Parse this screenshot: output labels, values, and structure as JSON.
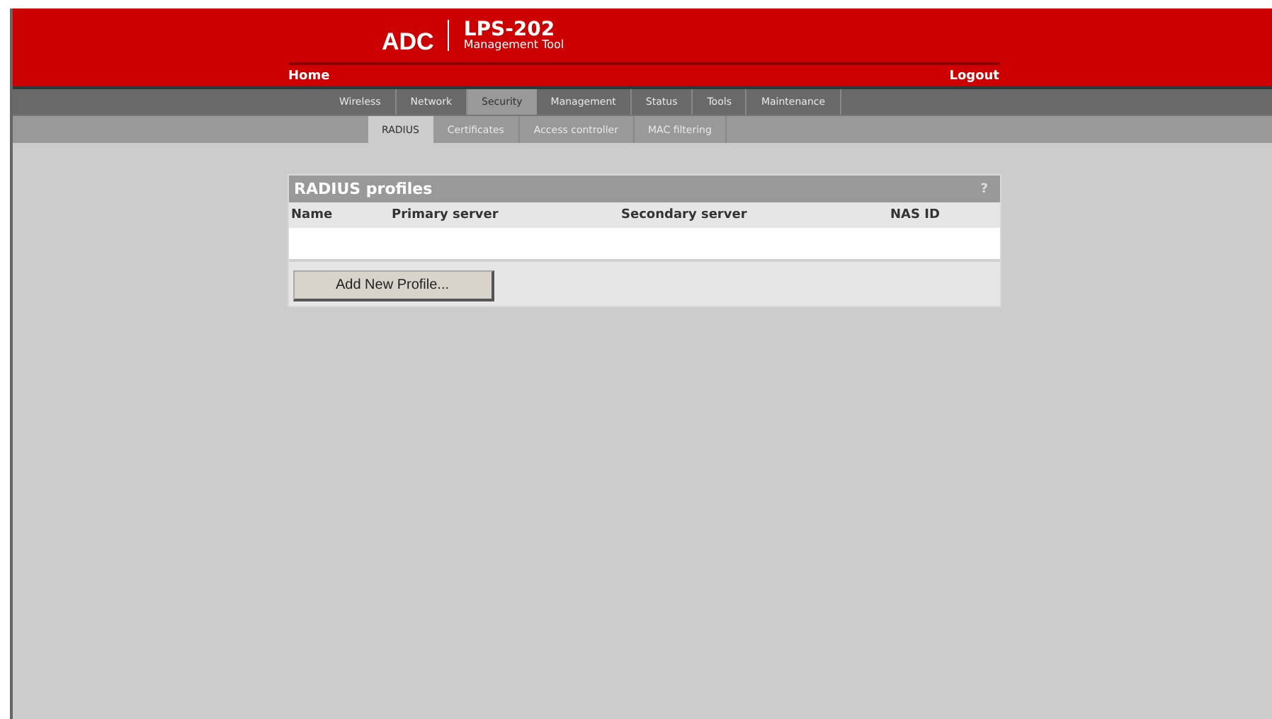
{
  "header": {
    "logo": "ADC",
    "product": "LPS-202",
    "subtitle": "Management Tool",
    "home_link": "Home",
    "logout_link": "Logout"
  },
  "tabs": [
    {
      "label": "Wireless",
      "selected": false
    },
    {
      "label": "Network",
      "selected": false
    },
    {
      "label": "Security",
      "selected": true
    },
    {
      "label": "Management",
      "selected": false
    },
    {
      "label": "Status",
      "selected": false
    },
    {
      "label": "Tools",
      "selected": false
    },
    {
      "label": "Maintenance",
      "selected": false
    }
  ],
  "subtabs": [
    {
      "label": "RADIUS",
      "selected": true
    },
    {
      "label": "Certificates",
      "selected": false
    },
    {
      "label": "Access controller",
      "selected": false
    },
    {
      "label": "MAC filtering",
      "selected": false
    }
  ],
  "panel": {
    "title": "RADIUS profiles",
    "help": "?",
    "columns": [
      "Name",
      "Primary server",
      "Secondary server",
      "NAS ID"
    ],
    "button": "Add New Profile..."
  }
}
